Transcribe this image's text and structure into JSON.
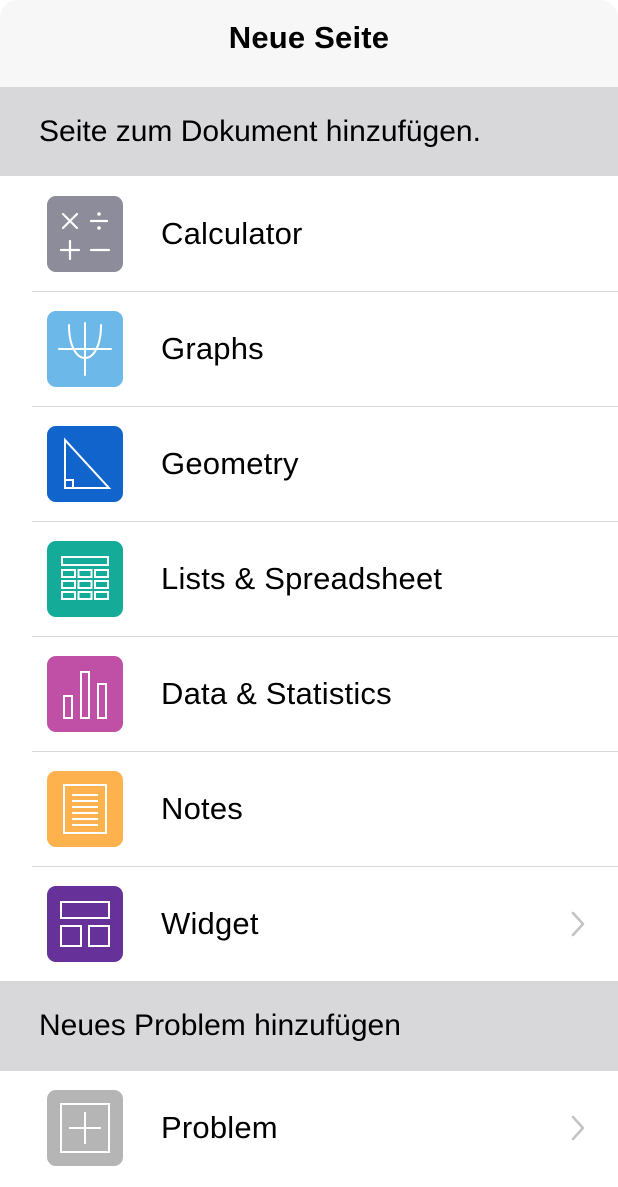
{
  "header": {
    "title": "Neue Seite"
  },
  "sections": [
    {
      "title": "Seite zum Dokument hinzufügen.",
      "items": [
        {
          "label": "Calculator",
          "icon": "calculator-icon",
          "color": "#8c8c9a",
          "has_chevron": false
        },
        {
          "label": "Graphs",
          "icon": "graphs-icon",
          "color": "#6cb8e8",
          "has_chevron": false
        },
        {
          "label": "Geometry",
          "icon": "geometry-icon",
          "color": "#1064cc",
          "has_chevron": false
        },
        {
          "label": "Lists & Spreadsheet",
          "icon": "spreadsheet-icon",
          "color": "#14ab98",
          "has_chevron": false
        },
        {
          "label": "Data & Statistics",
          "icon": "statistics-icon",
          "color": "#c050a6",
          "has_chevron": false
        },
        {
          "label": "Notes",
          "icon": "notes-icon",
          "color": "#fdb24e",
          "has_chevron": false
        },
        {
          "label": "Widget",
          "icon": "widget-icon",
          "color": "#66329a",
          "has_chevron": true
        }
      ]
    },
    {
      "title": "Neues Problem hinzufügen",
      "items": [
        {
          "label": "Problem",
          "icon": "problem-icon",
          "color": "#b5b5b5",
          "has_chevron": true
        }
      ]
    }
  ],
  "colors": {
    "navbar_bg": "#f7f7f7",
    "section_header_bg": "#d8d8da",
    "separator": "#d9d9dc",
    "chevron": "#c4c4c8"
  }
}
